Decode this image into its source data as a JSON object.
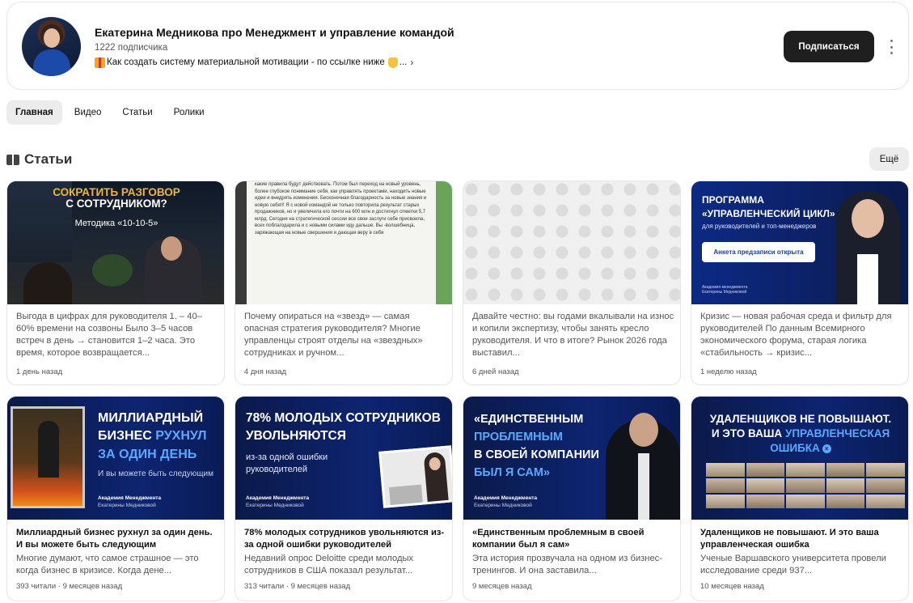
{
  "channel": {
    "title": "Екатерина Медникова про Менеджмент и управление командой",
    "subscribers": "1222 подписчика",
    "description": "Как создать систему материальной мотивации - по ссылке ниже",
    "description_suffix": "...",
    "subscribe_label": "Подписаться",
    "icons": [
      "gift-icon",
      "pointing-hand-icon",
      "chevron-right-icon",
      "more-vertical-icon"
    ]
  },
  "tabs": [
    {
      "label": "Главная",
      "active": true
    },
    {
      "label": "Видео",
      "active": false
    },
    {
      "label": "Статьи",
      "active": false
    },
    {
      "label": "Ролики",
      "active": false
    }
  ],
  "section": {
    "title": "Статьи",
    "more_label": "Ещё"
  },
  "articles_row1": [
    {
      "thumb": {
        "line1": "СОКРАТИТЬ РАЗГОВОР",
        "line2": "С СОТРУДНИКОМ?",
        "line3": "Методика «10-10-5»"
      },
      "snippet": "Выгода в цифрах для руководителя 1. – 40–60% времени на созвоны Было 3–5 часов встреч в день → становится 1–2 часа. Это время, которое возвращается...",
      "meta": "1 день назад"
    },
    {
      "thumb": {
        "text": "какие правила будут действовать. Потом был переход на новый уровень, более глубокое понимание себя, как управлять проектами, находить новые идеи и внедрять изменения. Бесконечная благодарность за новые знания и новую себя!!! Я с новой командой не только повторила результат старых продажников, но и увеличила его почти на 600 млн и достигнул отметки 5,7 млрд. Сегодня на стратегической сессии все свои заслуги себе присвоила, всех поблагодарила и с новыми силами иду дальше. Вы -волшебница, заряжающая на новые свершения и дающая веру в себя"
      },
      "snippet": "Почему опираться на «звезд» — самая опасная стратегия руководителя? Многие управленцы строят отделы на «звездных» сотрудниках и ручном...",
      "meta": "4 дня назад"
    },
    {
      "thumb": {},
      "snippet": "Давайте честно: вы годами вкалывали на износ и копили экспертизу, чтобы занять кресло руководителя. И что в итоге? Рынок 2026 года выставил...",
      "meta": "6 дней назад"
    },
    {
      "thumb": {
        "line1": "ПРОГРАММА",
        "line2": "«УПРАВЛЕНЧЕСКИЙ ЦИКЛ»",
        "line3": "для руководителей и топ-менеджеров",
        "button": "Анкета предзаписи открыта",
        "brand": "Академия менеджмента Екатерины Медниковой"
      },
      "snippet": "Кризис — новая рабочая среда и фильтр для руководителей По данным Всемирного экономического форума, старая логика «стабильность → кризис...",
      "meta": "1 неделю назад"
    }
  ],
  "articles_row2": [
    {
      "thumb": {
        "line1": "МИЛЛИАРДНЫЙ",
        "line2a": "БИЗНЕС ",
        "line2b": "РУХНУЛ",
        "line3": "ЗА ОДИН ДЕНЬ",
        "line4": "И вы можете быть следующим",
        "brand1": "Академия Менеджмента",
        "brand2": "Екатерины Медниковой"
      },
      "title": "Миллиардный бизнес рухнул за один день. И вы можете быть следующим",
      "snippet": "Многие думают, что самое страшное — это когда бизнес в кризисе. Когда дене...",
      "meta": "393 читали · 9 месяцев назад"
    },
    {
      "thumb": {
        "line1": "78% МОЛОДЫХ СОТРУДНИКОВ",
        "line2": "УВОЛЬНЯЮТСЯ",
        "line3": "из-за одной ошибки",
        "line4": "руководителей",
        "brand1": "Академия Менеджмента",
        "brand2": "Екатерины Медниковой"
      },
      "title": "78% молодых сотрудников увольняются из-за одной ошибки руководителей",
      "snippet": "Недавний опрос Deloitte среди молодых сотрудников в США показал результат...",
      "meta": "313 читали · 9 месяцев назад"
    },
    {
      "thumb": {
        "line1": "«ЕДИНСТВЕННЫМ",
        "line2": "ПРОБЛЕМНЫМ",
        "line3": "В СВОЕЙ КОМПАНИИ",
        "line4": "БЫЛ Я САМ»",
        "brand1": "Академия Менеджмента",
        "brand2": "Екатерины Медниковой"
      },
      "title": "«Единственным проблемным в своей компании был я сам»",
      "snippet": "Эта история прозвучала на одном из бизнес-тренингов. И она заставила...",
      "meta": "9 месяцев назад"
    },
    {
      "thumb": {
        "line1": "УДАЛЕНЩИКОВ НЕ ПОВЫШАЮТ.",
        "line2a": "И ЭТО ВАША ",
        "line2b": "УПРАВЛЕНЧЕСКАЯ",
        "line3": "ОШИБКА"
      },
      "title": "Удаленщиков не повышают. И это ваша управленческая ошибка",
      "snippet": "Ученые Варшавского университета провели исследование среди 937...",
      "meta": "10 месяцев назад"
    }
  ]
}
